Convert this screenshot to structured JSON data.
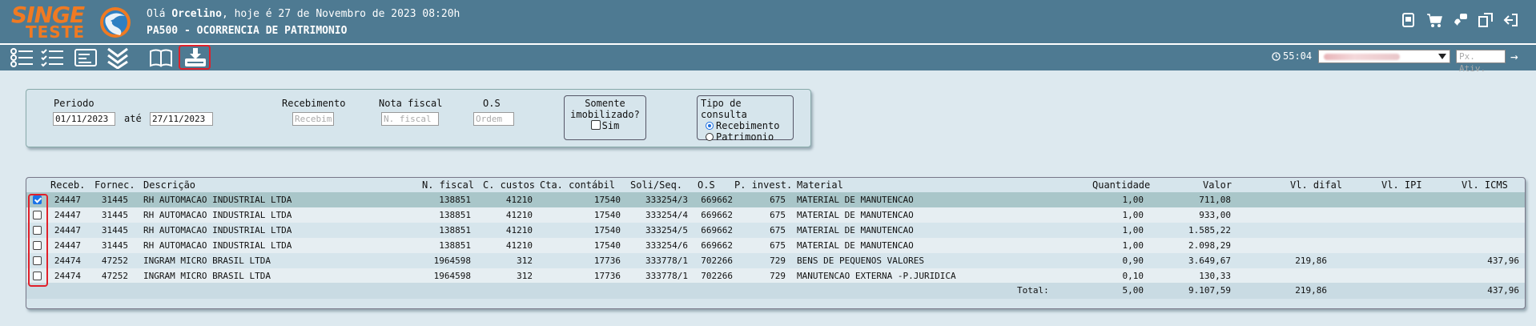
{
  "header": {
    "logo_text": "SINGE",
    "logo_sub": "TESTE",
    "greeting_prefix": "Olá ",
    "user_name": "Orcelino",
    "greeting_suffix": ", hoje é 27 de Novembro de 2023 08:20h",
    "page_title": "PA500 - OCORRENCIA DE PATRIMONIO",
    "icons": [
      "report-icon",
      "cart-icon",
      "support-icon",
      "window-icon",
      "logout-icon"
    ]
  },
  "toolbar": {
    "icons": [
      "list-icon",
      "checklist-icon",
      "card-icon",
      "collapse-icon",
      "book-icon",
      "export-icon"
    ],
    "timer": "55:04",
    "next_activity_placeholder": "Px. Ativ."
  },
  "filter": {
    "periodo_label": "Periodo",
    "date_from": "01/11/2023",
    "ate_label": "até",
    "date_to": "27/11/2023",
    "recebimento_label": "Recebimento",
    "recebimento_placeholder": "Recebim",
    "nota_fiscal_label": "Nota fiscal",
    "nota_fiscal_placeholder": "N. fiscal",
    "os_label": "O.S",
    "os_placeholder": "Ordem",
    "somente_label_1": "Somente",
    "somente_label_2": "imobilizado?",
    "sim_label": "Sim",
    "tipo_label": "Tipo de consulta",
    "tipo_opt1": "Recebimento",
    "tipo_opt2": "Patrimonio"
  },
  "grid": {
    "headers": {
      "receb": "Receb.",
      "fornec": "Fornec.",
      "descricao": "Descrição",
      "nfiscal": "N. fiscal",
      "ccustos": "C. custos",
      "cta": "Cta. contábil",
      "soli": "Soli/Seq.",
      "os": "O.S",
      "pinvest": "P. invest.",
      "material": "Material",
      "quantidade": "Quantidade",
      "valor": "Valor",
      "vldifal": "Vl. difal",
      "vlipi": "Vl. IPI",
      "vlicms": "Vl. ICMS"
    },
    "rows": [
      {
        "checked": true,
        "receb": "24447",
        "fornec": "31445",
        "descricao": "RH AUTOMACAO INDUSTRIAL LTDA",
        "nfiscal": "138851",
        "ccustos": "41210",
        "cta": "17540",
        "soli": "333254/3",
        "os": "669662",
        "pinvest": "675",
        "material": "MATERIAL DE MANUTENCAO",
        "quantidade": "1,00",
        "valor": "711,08",
        "vldifal": "",
        "vlipi": "",
        "vlicms": ""
      },
      {
        "checked": false,
        "receb": "24447",
        "fornec": "31445",
        "descricao": "RH AUTOMACAO INDUSTRIAL LTDA",
        "nfiscal": "138851",
        "ccustos": "41210",
        "cta": "17540",
        "soli": "333254/4",
        "os": "669662",
        "pinvest": "675",
        "material": "MATERIAL DE MANUTENCAO",
        "quantidade": "1,00",
        "valor": "933,00",
        "vldifal": "",
        "vlipi": "",
        "vlicms": ""
      },
      {
        "checked": false,
        "receb": "24447",
        "fornec": "31445",
        "descricao": "RH AUTOMACAO INDUSTRIAL LTDA",
        "nfiscal": "138851",
        "ccustos": "41210",
        "cta": "17540",
        "soli": "333254/5",
        "os": "669662",
        "pinvest": "675",
        "material": "MATERIAL DE MANUTENCAO",
        "quantidade": "1,00",
        "valor": "1.585,22",
        "vldifal": "",
        "vlipi": "",
        "vlicms": ""
      },
      {
        "checked": false,
        "receb": "24447",
        "fornec": "31445",
        "descricao": "RH AUTOMACAO INDUSTRIAL LTDA",
        "nfiscal": "138851",
        "ccustos": "41210",
        "cta": "17540",
        "soli": "333254/6",
        "os": "669662",
        "pinvest": "675",
        "material": "MATERIAL DE MANUTENCAO",
        "quantidade": "1,00",
        "valor": "2.098,29",
        "vldifal": "",
        "vlipi": "",
        "vlicms": ""
      },
      {
        "checked": false,
        "receb": "24474",
        "fornec": "47252",
        "descricao": "INGRAM MICRO BRASIL LTDA",
        "nfiscal": "1964598",
        "ccustos": "312",
        "cta": "17736",
        "soli": "333778/1",
        "os": "702266",
        "pinvest": "729",
        "material": "BENS DE PEQUENOS VALORES",
        "quantidade": "0,90",
        "valor": "3.649,67",
        "vldifal": "219,86",
        "vlipi": "",
        "vlicms": "437,96"
      },
      {
        "checked": false,
        "receb": "24474",
        "fornec": "47252",
        "descricao": "INGRAM MICRO BRASIL LTDA",
        "nfiscal": "1964598",
        "ccustos": "312",
        "cta": "17736",
        "soli": "333778/1",
        "os": "702266",
        "pinvest": "729",
        "material": "MANUTENCAO EXTERNA -P.JURIDICA",
        "quantidade": "0,10",
        "valor": "130,33",
        "vldifal": "",
        "vlipi": "",
        "vlicms": ""
      }
    ],
    "total": {
      "label": "Total:",
      "quantidade": "5,00",
      "valor": "9.107,59",
      "vldifal": "219,86",
      "vlicms": "437,96"
    }
  },
  "colors": {
    "header_bg": "#4e7a92",
    "page_bg": "#dde9ef",
    "logo_orange": "#f07a22",
    "highlight_red": "#e0202a",
    "selected_row": "#a9c6c9"
  }
}
